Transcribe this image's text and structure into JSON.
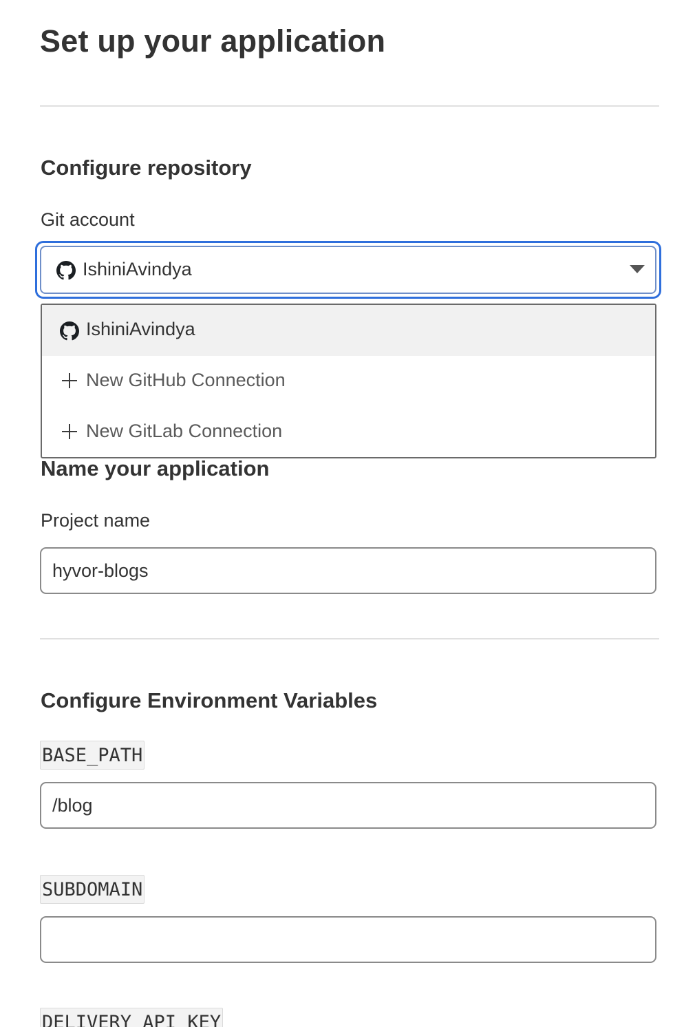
{
  "page": {
    "title": "Set up your application"
  },
  "repository": {
    "heading": "Configure repository",
    "git_account_label": "Git account",
    "selected_account": "IshiniAvindya",
    "dropdown_options": [
      {
        "label": "IshiniAvindya",
        "icon": "github-icon",
        "selected": true
      },
      {
        "label": "New GitHub Connection",
        "icon": "plus-icon",
        "selected": false
      },
      {
        "label": "New GitLab Connection",
        "icon": "plus-icon",
        "selected": false
      }
    ]
  },
  "application": {
    "heading": "Name your application",
    "project_name_label": "Project name",
    "project_name_value": "hyvor-blogs"
  },
  "environment": {
    "heading": "Configure Environment Variables",
    "variables": [
      {
        "name": "BASE_PATH",
        "value": "/blog"
      },
      {
        "name": "SUBDOMAIN",
        "value": ""
      },
      {
        "name": "DELIVERY_API_KEY",
        "value": ""
      }
    ]
  },
  "colors": {
    "focus_ring": "#2f6fdc",
    "selected_option_bg": "#f1f1f1",
    "divider": "#e0e0e0"
  }
}
